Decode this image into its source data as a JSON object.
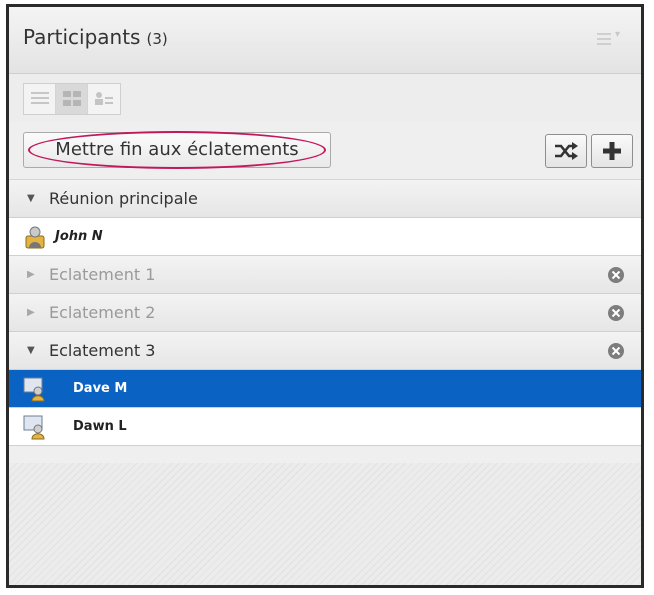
{
  "header": {
    "title": "Participants",
    "count": "(3)"
  },
  "toolbar": {
    "end_button_label": "Mettre fin aux éclatements",
    "highlight_color": "#c2185b"
  },
  "groups": {
    "main": {
      "label": "Réunion principale",
      "expanded": true
    },
    "breakout1": {
      "label": "Eclatement 1",
      "expanded": false
    },
    "breakout2": {
      "label": "Eclatement 2",
      "expanded": false
    },
    "breakout3": {
      "label": "Eclatement 3",
      "expanded": true
    }
  },
  "users": {
    "john": {
      "name": "John N",
      "role": "host"
    },
    "dave": {
      "name": "Dave M",
      "selected": true
    },
    "dawn": {
      "name": "Dawn L"
    }
  },
  "colors": {
    "selection": "#0a62c2",
    "panel_border": "#2a2a2a"
  }
}
